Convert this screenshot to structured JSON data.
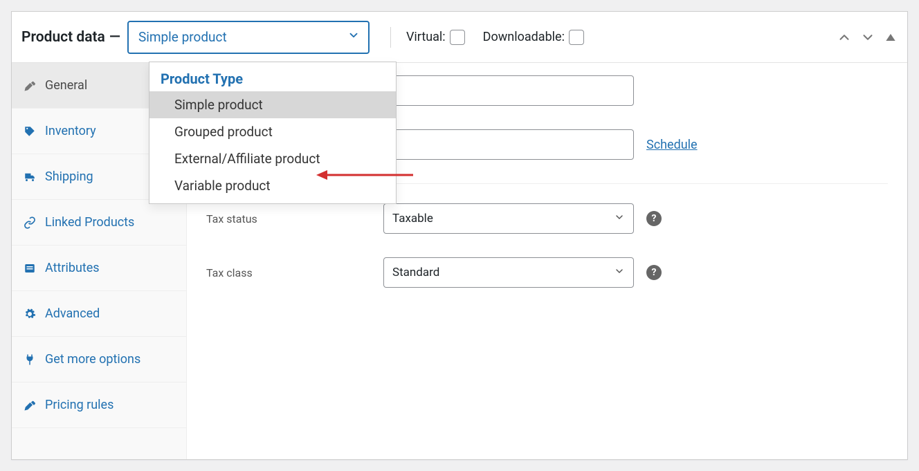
{
  "header": {
    "title": "Product data",
    "select_value": "Simple product",
    "virtual_label": "Virtual:",
    "downloadable_label": "Downloadable:"
  },
  "dropdown": {
    "group_label": "Product Type",
    "options": [
      "Simple product",
      "Grouped product",
      "External/Affiliate product",
      "Variable product"
    ]
  },
  "sidebar": {
    "items": [
      {
        "label": "General"
      },
      {
        "label": "Inventory"
      },
      {
        "label": "Shipping"
      },
      {
        "label": "Linked Products"
      },
      {
        "label": "Attributes"
      },
      {
        "label": "Advanced"
      },
      {
        "label": "Get more options"
      },
      {
        "label": "Pricing rules"
      }
    ]
  },
  "form": {
    "schedule_label": "Schedule",
    "tax_status": {
      "label": "Tax status",
      "value": "Taxable"
    },
    "tax_class": {
      "label": "Tax class",
      "value": "Standard"
    }
  },
  "colors": {
    "accent": "#2271b1",
    "annotation": "#d32f2f"
  }
}
